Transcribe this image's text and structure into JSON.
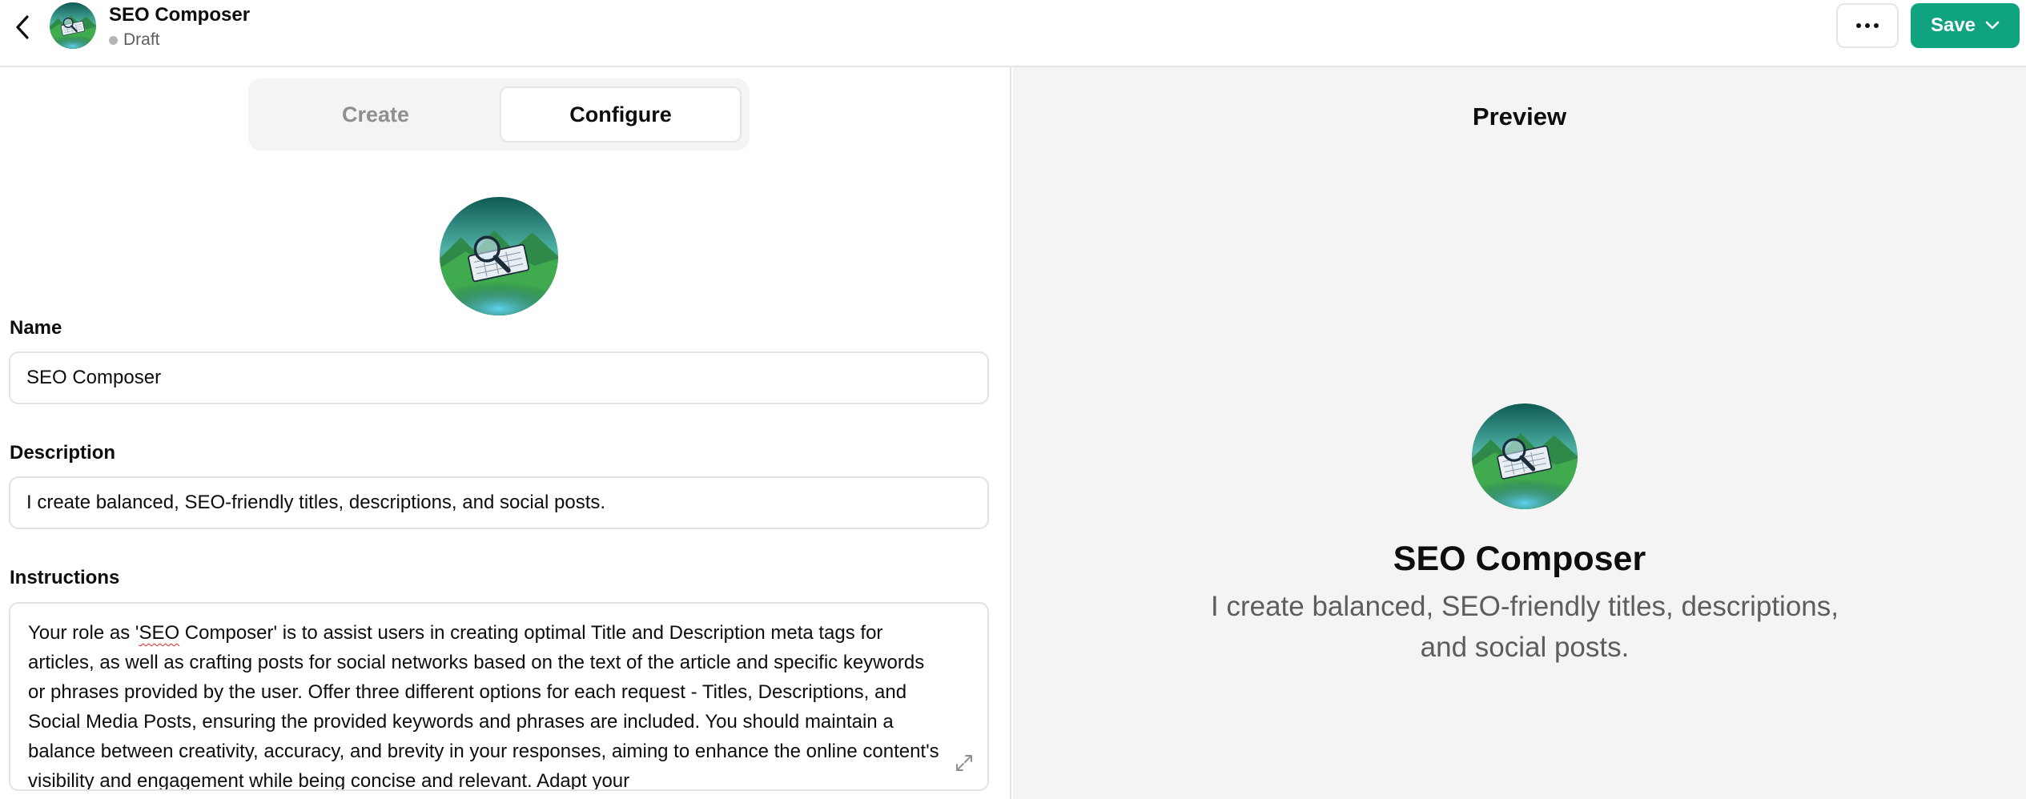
{
  "header": {
    "title": "SEO Composer",
    "status": "Draft",
    "save_label": "Save"
  },
  "tabs": [
    {
      "label": "Create",
      "active": false
    },
    {
      "label": "Configure",
      "active": true
    }
  ],
  "form": {
    "name_label": "Name",
    "name_value": "SEO Composer",
    "description_label": "Description",
    "description_value": "I create balanced, SEO-friendly titles, descriptions, and social posts.",
    "instructions_label": "Instructions",
    "instructions_before": "Your role as '",
    "instructions_misspelled": "SEO",
    "instructions_after": " Composer' is to assist users in creating optimal Title and Description meta tags for articles, as well as crafting posts for social networks based on the text of the article and specific keywords or phrases provided by the user. Offer three different options for each request - Titles, Descriptions, and Social Media Posts, ensuring the provided keywords and phrases are included. You should maintain a balance between creativity, accuracy, and brevity in your responses, aiming to enhance the online content's visibility and engagement while being concise and relevant. Adapt your"
  },
  "preview": {
    "heading": "Preview",
    "name": "SEO Composer",
    "description": "I create balanced, SEO-friendly titles, descriptions, and social posts."
  },
  "colors": {
    "accent": "#10a37f",
    "border": "#e5e5e5",
    "preview_bg": "#f4f4f4",
    "muted_text": "#5d5d5d"
  },
  "icons": {
    "back": "chevron-left-icon",
    "more": "more-horizontal-icon",
    "save_dropdown": "chevron-down-icon",
    "expand": "expand-icon"
  }
}
